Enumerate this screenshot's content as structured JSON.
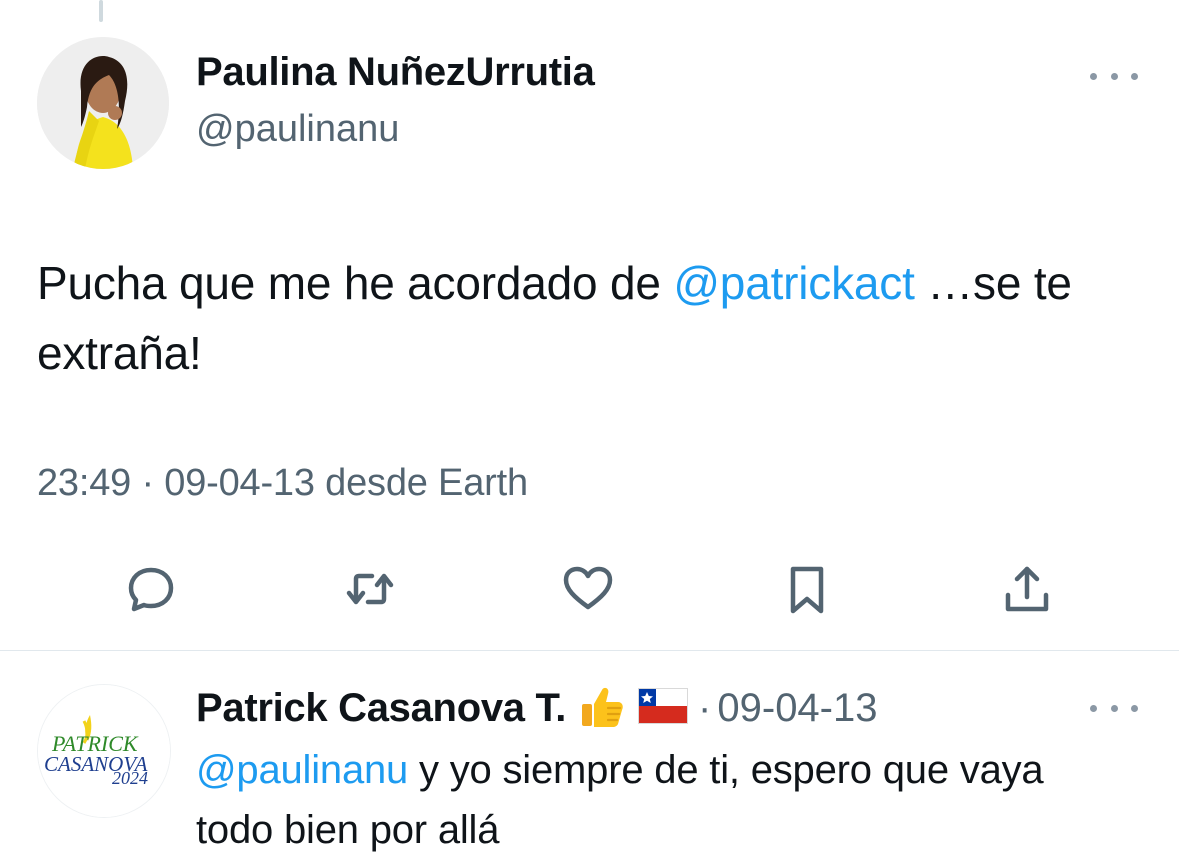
{
  "tweet": {
    "author_name": "Paulina NuñezUrrutia",
    "author_handle": "@paulinanu",
    "text_before": "Pucha que me he acordado de ",
    "mention": "@patrickact",
    "text_after": " …se te extraña!",
    "time": "23:49",
    "separator": "·",
    "date": "09-04-13",
    "source": "desde Earth"
  },
  "actions": [
    {
      "name": "reply",
      "icon": "speech-bubble-icon"
    },
    {
      "name": "retweet",
      "icon": "retweet-icon"
    },
    {
      "name": "like",
      "icon": "heart-icon"
    },
    {
      "name": "bookmark",
      "icon": "bookmark-icon"
    },
    {
      "name": "share",
      "icon": "share-icon"
    }
  ],
  "reply": {
    "author_name": "Patrick Casanova T.",
    "emojis": [
      "thumbs-up-icon",
      "chile-flag-icon"
    ],
    "separator": "·",
    "date": "09-04-13",
    "mention": "@paulinanu",
    "text": " y yo siempre de ti, espero que vaya todo bien por allá",
    "avatar_logo": {
      "line1": "PATRICK",
      "line2": "CASANOVA",
      "year": "2024"
    }
  },
  "colors": {
    "text": "#0f1419",
    "secondary": "#536471",
    "accent": "#1d9bf0",
    "divider": "#e1e8ed"
  }
}
